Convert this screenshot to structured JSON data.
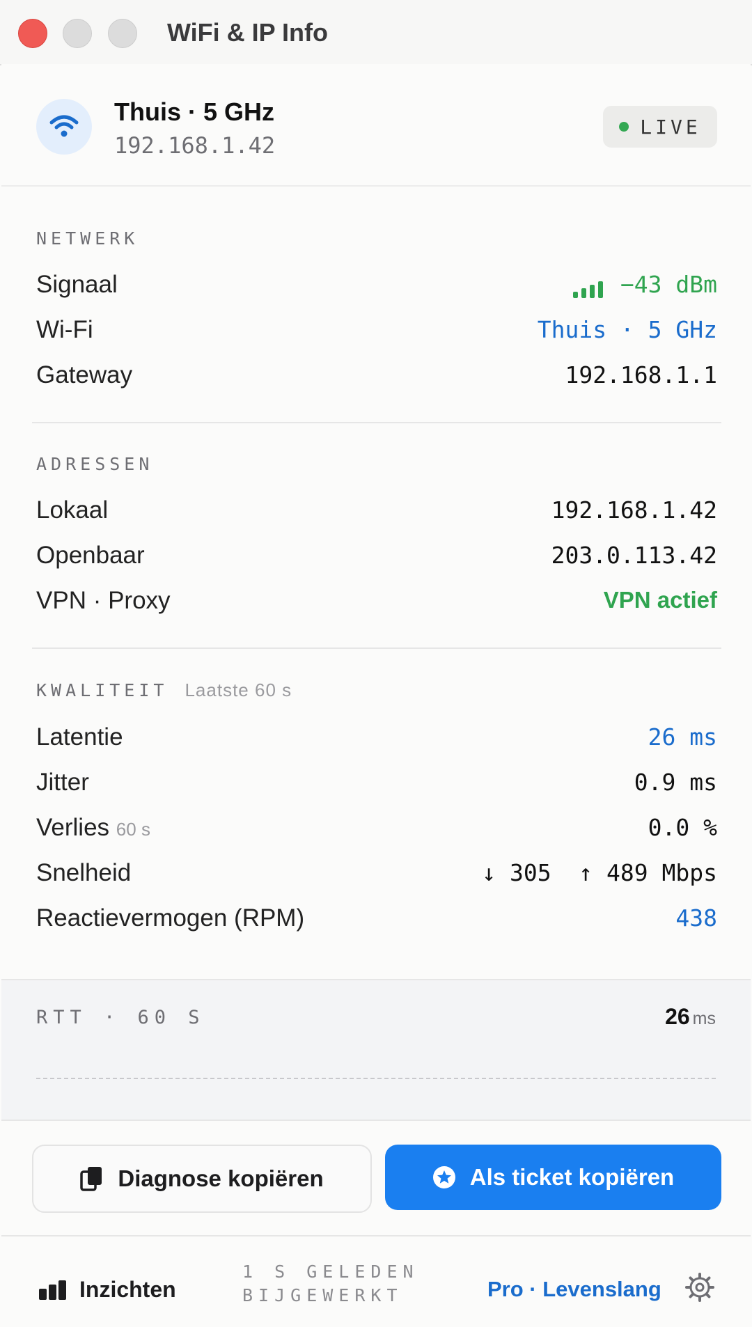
{
  "window": {
    "title": "WiFi & IP Info"
  },
  "header": {
    "network_name": "Thuis · 5 GHz",
    "ip": "192.168.1.42",
    "live_label": "LIVE"
  },
  "netwerk": {
    "heading": "NETWERK",
    "rows": [
      {
        "label": "Signaal",
        "value": "−43 dBm"
      },
      {
        "label": "Wi-Fi",
        "value": "Thuis · 5 GHz"
      },
      {
        "label": "Gateway",
        "value": "192.168.1.1"
      }
    ]
  },
  "adressen": {
    "heading": "ADRESSEN",
    "rows": [
      {
        "label": "Lokaal",
        "value": "192.168.1.42"
      },
      {
        "label": "Openbaar",
        "value": "203.0.113.42"
      },
      {
        "label": "VPN · Proxy",
        "value": "VPN actief"
      }
    ]
  },
  "kwaliteit": {
    "heading": "KWALITEIT",
    "subheading": "Laatste 60 s",
    "rows": [
      {
        "label": "Latentie",
        "value": "26 ms"
      },
      {
        "label": "Jitter",
        "value": "0.9 ms"
      },
      {
        "label": "Verlies",
        "label_suffix": "60 s",
        "value": "0.0 %"
      },
      {
        "label": "Snelheid",
        "value": "↓ 305  ↑ 489 Mbps"
      },
      {
        "label": "Reactievermogen (RPM)",
        "value": "438"
      }
    ]
  },
  "rtt": {
    "label": "RTT · 60 S",
    "value": "26",
    "unit": "ms"
  },
  "buttons": {
    "diagnose": "Diagnose kopiëren",
    "ticket": "Als ticket kopiëren"
  },
  "footer": {
    "insights": "Inzichten",
    "updated_line1": "1 S GELEDEN",
    "updated_line2": "BIJGEWERKT",
    "plan": "Pro · Levenslang"
  },
  "colors": {
    "accent": "#1a7ff0",
    "green": "#2fa44f",
    "blue_text": "#1a6ccc"
  }
}
